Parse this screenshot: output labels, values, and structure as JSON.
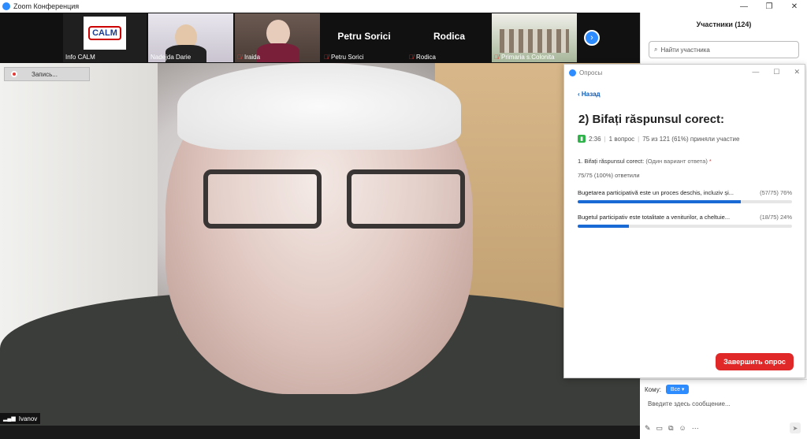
{
  "window": {
    "title": "Zoom Конференция",
    "min": "—",
    "max": "❐",
    "close": "✕"
  },
  "record": {
    "label": "Запись..."
  },
  "thumbnails": [
    {
      "name": "Info CALM",
      "logo": "CALM",
      "muted": false
    },
    {
      "name": "Nadejda Darie",
      "muted": false
    },
    {
      "name": "Iraida",
      "muted": true
    },
    {
      "name": "Petru Sorici",
      "muted": true
    },
    {
      "name": "Rodica",
      "muted": true
    },
    {
      "name": "Primaria s.Colonita",
      "muted": true
    }
  ],
  "active_speaker": {
    "name": "Ivanov"
  },
  "participants": {
    "title": "Участники (124)",
    "search_placeholder": "Найти участника"
  },
  "poll": {
    "window_title": "Опросы",
    "back": "Назад",
    "title": "2) Bifați răspunsul corect:",
    "time": "2:36",
    "questions_count": "1 вопрос",
    "participation": "75 из 121 (61%) приняли участие",
    "question": "1. Bifați răspunsul corect:",
    "question_type": "(Один вариант ответа)",
    "required_mark": "*",
    "answered": "75/75 (100%) ответили",
    "options": [
      {
        "label": "Bugetarea participativă  este un proces deschis, incluziv și...",
        "result": "(57/75) 76%",
        "fraction": 0.76
      },
      {
        "label": "Bugetul participativ  este totalitate a veniturilor, a cheltuie...",
        "result": "(18/75) 24%",
        "fraction": 0.24
      }
    ],
    "end_button": "Завершить опрос"
  },
  "chat": {
    "to_label": "Кому:",
    "to_value": "Все",
    "placeholder": "Введите здесь сообщение..."
  },
  "colors": {
    "accent": "#2d8cff",
    "danger": "#e02828",
    "bar": "#1a6ad6"
  }
}
